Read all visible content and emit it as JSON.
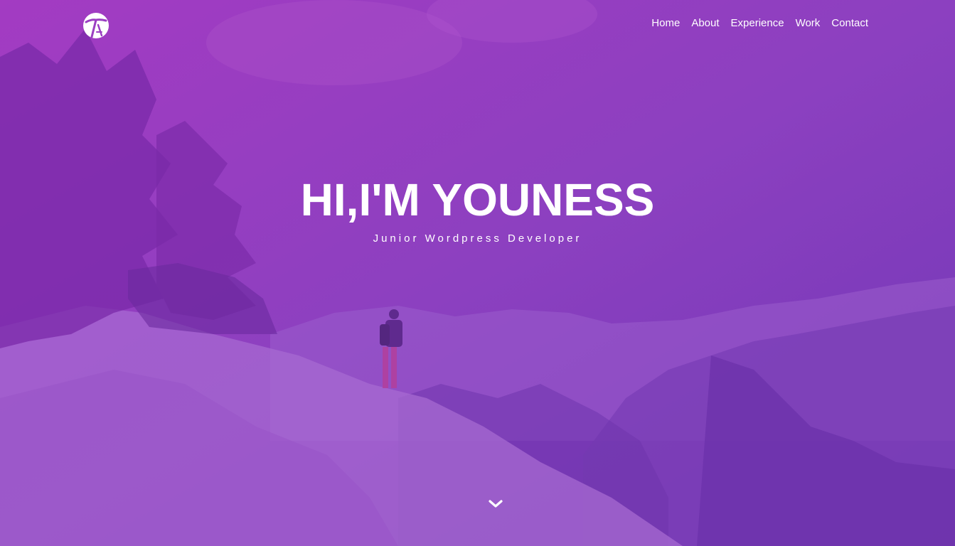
{
  "nav": {
    "logo_icon": "circular-monogram-logo-icon",
    "items": [
      {
        "label": "Home"
      },
      {
        "label": "About"
      },
      {
        "label": "Experience"
      },
      {
        "label": "Work"
      },
      {
        "label": "Contact"
      }
    ]
  },
  "hero": {
    "title": "HI,I'M YOUNESS",
    "subtitle": "Junior Wordpress Developer",
    "scroll_icon": "chevron-down-icon",
    "overlay_color": "#8a3bbf"
  }
}
